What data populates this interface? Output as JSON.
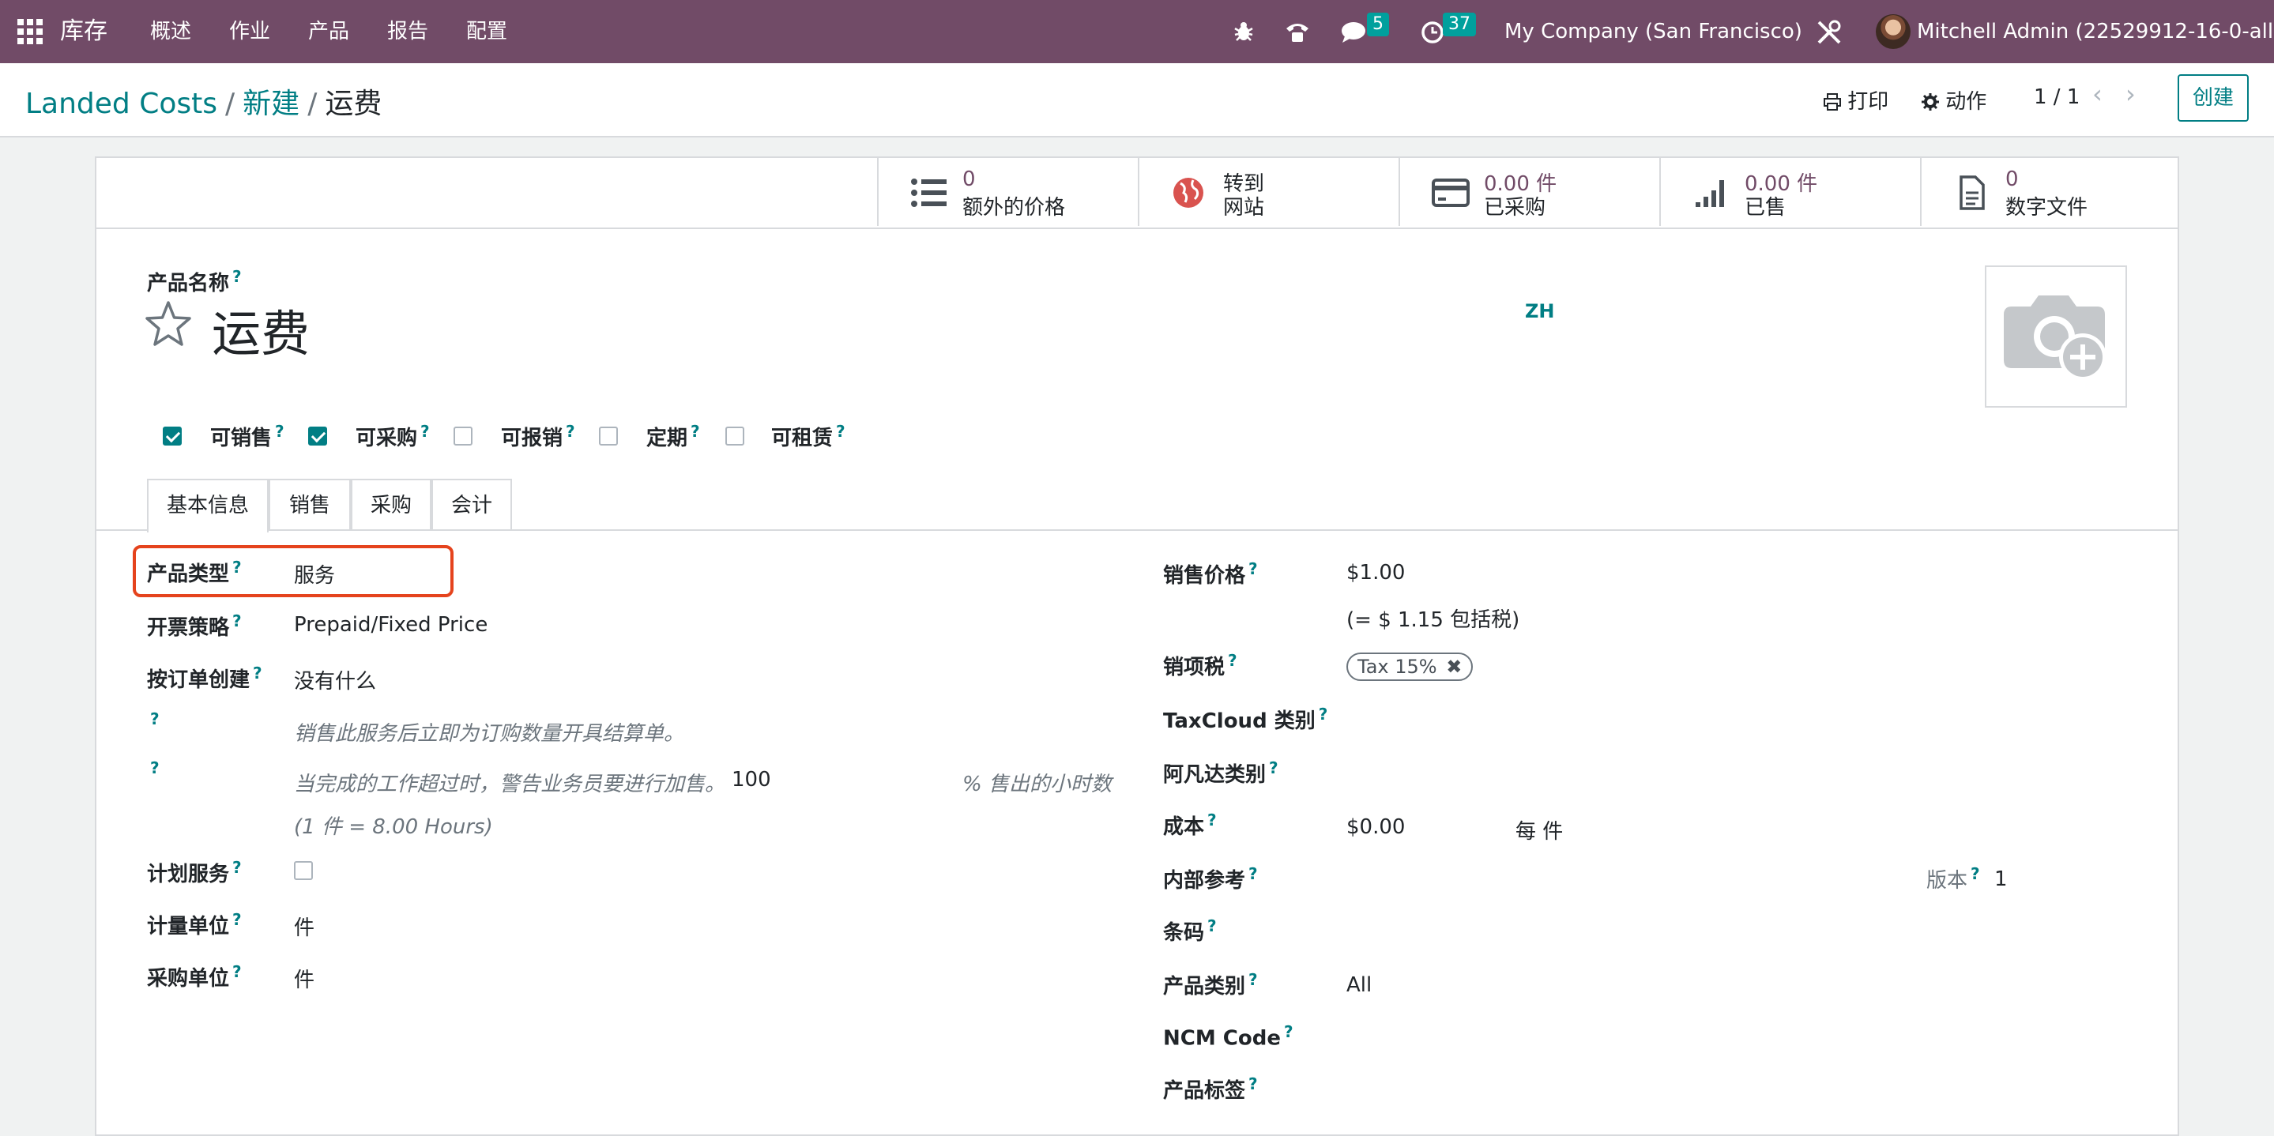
{
  "navbar": {
    "app_name": "库存",
    "menus": [
      "概述",
      "作业",
      "产品",
      "报告",
      "配置"
    ],
    "messages_badge": "5",
    "activities_badge": "37",
    "company": "My Company (San Francisco)",
    "user": "Mitchell Admin (22529912-16-0-all)"
  },
  "breadcrumb": {
    "root": "Landed Costs",
    "sep": "/",
    "middle": "新建",
    "current": "运费"
  },
  "control": {
    "print": "打印",
    "action": "动作",
    "pager": "1 / 1",
    "create": "创建"
  },
  "stat_buttons": [
    {
      "line1": "0",
      "line2": "额外的价格",
      "icon": "list-icon"
    },
    {
      "line1": "转到",
      "line2": "网站",
      "icon": "globe-icon"
    },
    {
      "line1": "0.00 件",
      "line2": "已采购",
      "icon": "credit-card-icon"
    },
    {
      "line1": "0.00 件",
      "line2": "已售",
      "icon": "signal-icon"
    },
    {
      "line1": "0",
      "line2": "数字文件",
      "icon": "file-icon"
    }
  ],
  "product": {
    "name_label": "产品名称",
    "name": "运费",
    "lang": "ZH",
    "q": "?"
  },
  "flags": [
    {
      "label": "可销售",
      "checked": true
    },
    {
      "label": "可采购",
      "checked": true
    },
    {
      "label": "可报销",
      "checked": false
    },
    {
      "label": "定期",
      "checked": false
    },
    {
      "label": "可租赁",
      "checked": false
    }
  ],
  "tabs": [
    "基本信息",
    "销售",
    "采购",
    "会计"
  ],
  "left": {
    "type_label": "产品类型",
    "type_value": "服务",
    "invoice_label": "开票策略",
    "invoice_value": "Prepaid/Fixed Price",
    "create_label": "按订单创建",
    "create_value": "没有什么",
    "hint1": "销售此服务后立即为订购数量开具结算单。",
    "hint2": "当完成的工作超过时，警告业务员要进行加售。",
    "hint2_value": "100",
    "hint2_unit": "% 售出的小时数",
    "hint3": "(1 件 = 8.00 Hours)",
    "planning_label": "计划服务",
    "uom_label": "计量单位",
    "uom_value": "件",
    "po_uom_label": "采购单位",
    "po_uom_value": "件"
  },
  "right": {
    "price_label": "销售价格",
    "price_value": "$1.00",
    "price_incl": "(= $ 1.15 包括税)",
    "tax_label": "销项税",
    "tax_tag": "Tax 15%",
    "taxcloud_label": "TaxCloud 类别",
    "avalara_label": "阿凡达类别",
    "cost_label": "成本",
    "cost_value": "$0.00",
    "cost_per": "每 件",
    "ref_label": "内部参考",
    "version_label": "版本",
    "version_value": "1",
    "barcode_label": "条码",
    "categ_label": "产品类别",
    "categ_value": "All",
    "ncm_label": "NCM Code",
    "tags_label": "产品标签"
  },
  "colors": {
    "navbar": "#714b67",
    "accent": "#017e84",
    "highlight": "#e5431d"
  }
}
